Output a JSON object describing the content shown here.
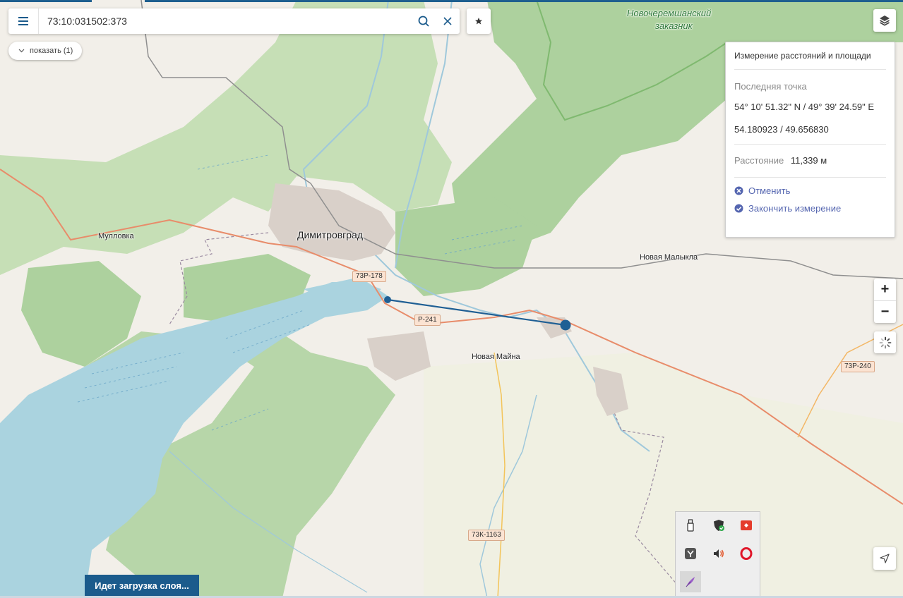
{
  "search": {
    "value": "73:10:031502:373"
  },
  "filter_pill": {
    "label": "показать (1)"
  },
  "map_labels": {
    "city": "Димитровград",
    "village_mullovka": "Мулловка",
    "village_novaya_maina": "Новая Майна",
    "village_novaya_malykla": "Новая Малыкла",
    "reserve_line1": "Новочеремшанский",
    "reserve_line2": "заказник"
  },
  "road_shields": {
    "r1": "73Р-178",
    "r2": "Р-241",
    "r3": "73Р-240",
    "r4": "73К-1163"
  },
  "measure_panel": {
    "title": "Измерение расстояний и площади",
    "last_point_label": "Последняя точка",
    "coord_dms": "54° 10' 51.32\" N / 49° 39' 24.59\" E",
    "coord_decimal": "54.180923 / 49.656830",
    "distance_label": "Расстояние",
    "distance_value": "11,339 м",
    "cancel_label": "Отменить",
    "finish_label": "Закончить измерение"
  },
  "zoom": {
    "in_label": "+",
    "out_label": "−"
  },
  "loading": {
    "label": "Идет загрузка слоя..."
  },
  "tray_icons": [
    "usb-icon",
    "shield-check-icon",
    "anydesk-icon",
    "yandex-icon",
    "speaker-icon",
    "opera-icon",
    "feather-icon"
  ],
  "colors": {
    "accent": "#1b5b8c",
    "measure_line": "#1f5f94",
    "link": "#5566b0",
    "water": "#aad3df",
    "forest": "#add19e",
    "primary_road": "#e88c6a"
  }
}
